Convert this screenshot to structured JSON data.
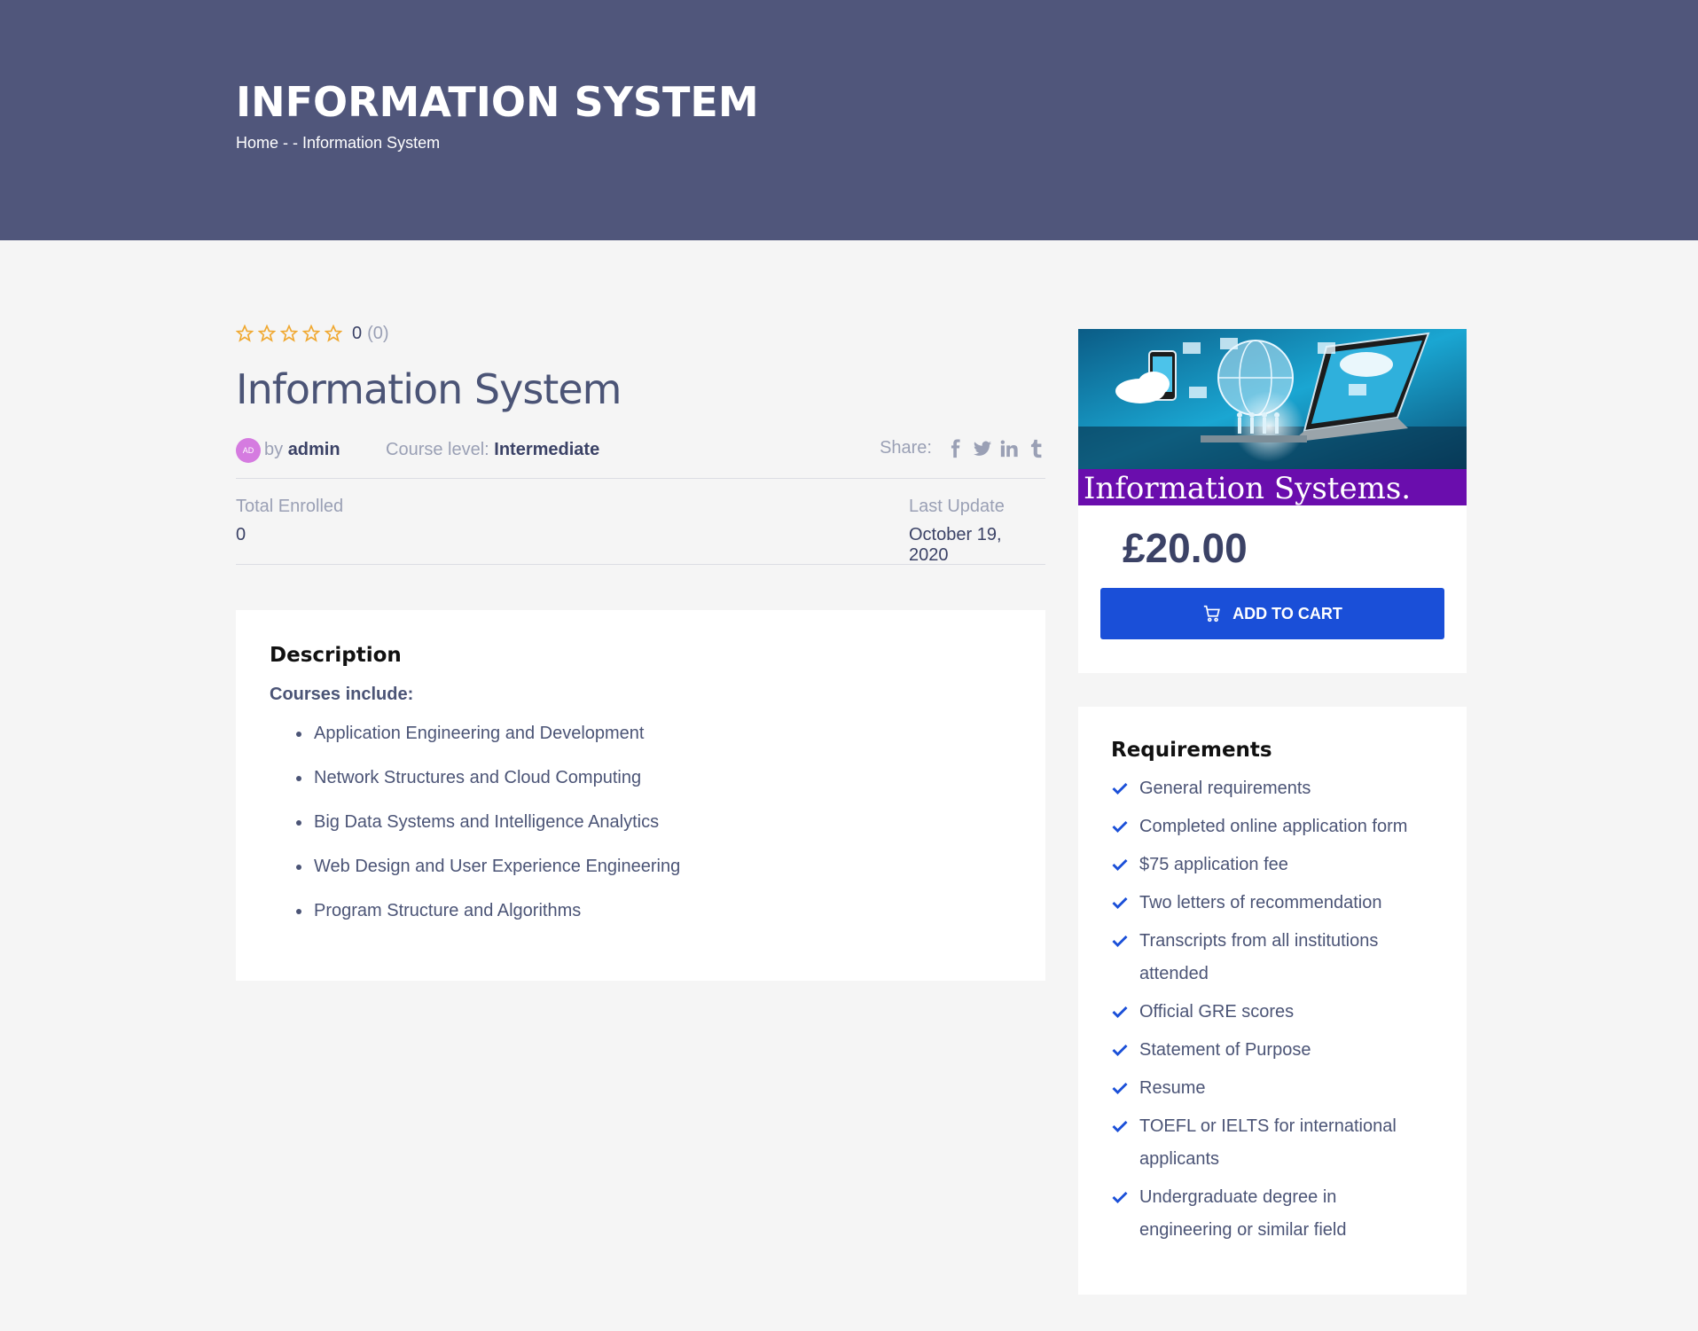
{
  "hero": {
    "title": "INFORMATION SYSTEM",
    "breadcrumb_home": "Home",
    "breadcrumb_sep": " - - ",
    "breadcrumb_current": "Information System"
  },
  "course": {
    "rating_value": "0",
    "rating_count": "(0)",
    "rating_stars_filled": 0,
    "rating_stars_total": 5,
    "title": "Information System",
    "avatar_initials": "AD",
    "by_label": "by",
    "author": "admin",
    "level_label": "Course level:",
    "level_value": "Intermediate",
    "share_label": "Share:",
    "share_icons": [
      "facebook-icon",
      "twitter-icon",
      "linkedin-icon",
      "tumblr-icon"
    ],
    "enrolled_label": "Total Enrolled",
    "enrolled_value": "0",
    "update_label": "Last Update",
    "update_value": "October 19, 2020"
  },
  "description": {
    "title": "Description",
    "subtitle": "Courses include:",
    "items": [
      "Application Engineering and Development",
      "Network Structures and Cloud Computing",
      "Big Data Systems and Intelligence Analytics",
      "Web Design and User Experience Engineering",
      "Program Structure and Algorithms"
    ]
  },
  "pricing": {
    "thumb_text": "Information Systems.",
    "price": "£20.00",
    "add_to_cart": "ADD TO CART",
    "colors": {
      "button": "#1a4fd8",
      "thumb_banner": "#6a0dad"
    }
  },
  "requirements": {
    "title": "Requirements",
    "items": [
      "General requirements",
      "Completed online application form",
      "$75 application fee",
      "Two letters of recommendation",
      "Transcripts from all institutions attended",
      "Official GRE scores",
      "Statement of Purpose",
      "Resume",
      "TOEFL or IELTS for international applicants",
      "Undergraduate degree in engineering or similar field"
    ]
  },
  "colors": {
    "hero_bg": "#50567b",
    "accent": "#1a4fd8",
    "star": "#f0a830"
  }
}
